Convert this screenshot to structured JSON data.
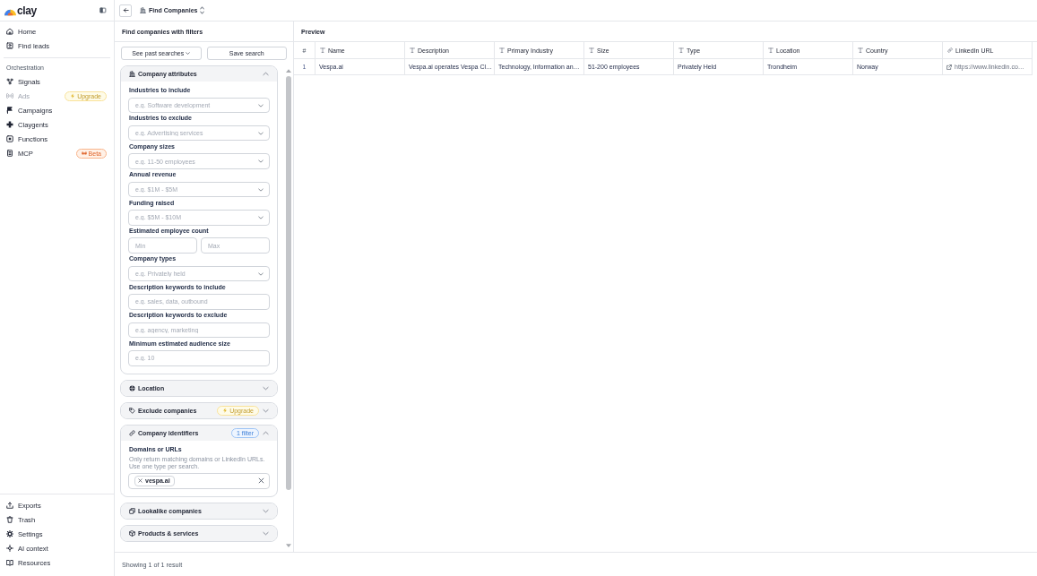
{
  "sidebar": {
    "logo": "clay",
    "main_items": [
      {
        "label": "Home"
      },
      {
        "label": "Find leads"
      }
    ],
    "section": {
      "title": "Orchestration",
      "items": [
        {
          "label": "Signals",
          "disabled": false
        },
        {
          "label": "Ads",
          "disabled": true,
          "badge": {
            "kind": "upgrade",
            "text": "Upgrade"
          }
        },
        {
          "label": "Campaigns",
          "disabled": false
        },
        {
          "label": "Claygents",
          "disabled": false
        },
        {
          "label": "Functions",
          "disabled": false
        },
        {
          "label": "MCP",
          "disabled": false,
          "badge": {
            "kind": "beta",
            "text": "Beta"
          }
        }
      ]
    },
    "footer_items": [
      {
        "label": "Exports"
      },
      {
        "label": "Trash"
      },
      {
        "label": "Settings"
      },
      {
        "label": "AI context"
      },
      {
        "label": "Resources"
      }
    ]
  },
  "header": {
    "title": "Find Companies"
  },
  "filters": {
    "title": "Find companies with filters",
    "buttons": [
      {
        "label": "See past searches",
        "kind": "dropdown"
      },
      {
        "label": "Save search",
        "kind": "plain"
      }
    ],
    "sections": [
      {
        "title": "Company attributes",
        "expanded": true,
        "fields": [
          {
            "label": "Industries to include",
            "kind": "select",
            "placeholder": "e.g. Software development"
          },
          {
            "label": "Industries to exclude",
            "kind": "select",
            "placeholder": "e.g. Advertising services"
          },
          {
            "label": "Company sizes",
            "kind": "select",
            "placeholder": "e.g. 11-50 employees"
          },
          {
            "label": "Annual revenue",
            "kind": "select",
            "placeholder": "e.g. $1M - $5M"
          },
          {
            "label": "Funding raised",
            "kind": "select",
            "placeholder": "e.g. $5M - $10M"
          },
          {
            "label": "Estimated employee count",
            "kind": "range",
            "inputs": [
              {
                "placeholder": "Min"
              },
              {
                "placeholder": "Max"
              }
            ]
          },
          {
            "label": "Company types",
            "kind": "select",
            "placeholder": "e.g. Privately held"
          },
          {
            "label": "Description keywords to include",
            "kind": "text",
            "placeholder": "e.g. sales, data, outbound"
          },
          {
            "label": "Description keywords to exclude",
            "kind": "text",
            "placeholder": "e.g. agency, marketing"
          },
          {
            "label": "Minimum estimated audience size",
            "kind": "text",
            "placeholder": "e.g. 10"
          }
        ]
      },
      {
        "title": "Location",
        "expanded": false
      },
      {
        "title": "Exclude companies",
        "expanded": false,
        "badge": {
          "kind": "upgrade",
          "text": "Upgrade"
        }
      },
      {
        "title": "Company identifiers",
        "expanded": true,
        "badge": {
          "kind": "count",
          "text": "1 filter"
        },
        "fields": [
          {
            "label": "Domains or URLs",
            "kind": "tags",
            "help": "Only return matching domains or LinkedIn URLs. Use one type per search.",
            "tags": [
              "vespa.ai"
            ]
          }
        ]
      },
      {
        "title": "Lookalike companies",
        "expanded": false
      },
      {
        "title": "Products & services",
        "expanded": false
      }
    ]
  },
  "preview": {
    "title": "Preview",
    "table": {
      "columns": [
        {
          "label": "#",
          "kind": "index"
        },
        {
          "label": "Name",
          "kind": "text"
        },
        {
          "label": "Description",
          "kind": "text"
        },
        {
          "label": "Primary Industry",
          "kind": "text"
        },
        {
          "label": "Size",
          "kind": "text"
        },
        {
          "label": "Type",
          "kind": "text"
        },
        {
          "label": "Location",
          "kind": "text"
        },
        {
          "label": "Country",
          "kind": "text"
        },
        {
          "label": "LinkedIn URL",
          "kind": "url"
        }
      ],
      "rows": [
        {
          "cells": [
            "1",
            "Vespa.ai",
            "Vespa.ai operates Vespa Cl…",
            "Technology, Information an…",
            "51-200 employees",
            "Privately Held",
            "Trondheim",
            "Norway",
            "https://www.linkedin.co…"
          ]
        }
      ]
    }
  },
  "status_bar": {
    "text": "Showing 1 of 1 result"
  }
}
